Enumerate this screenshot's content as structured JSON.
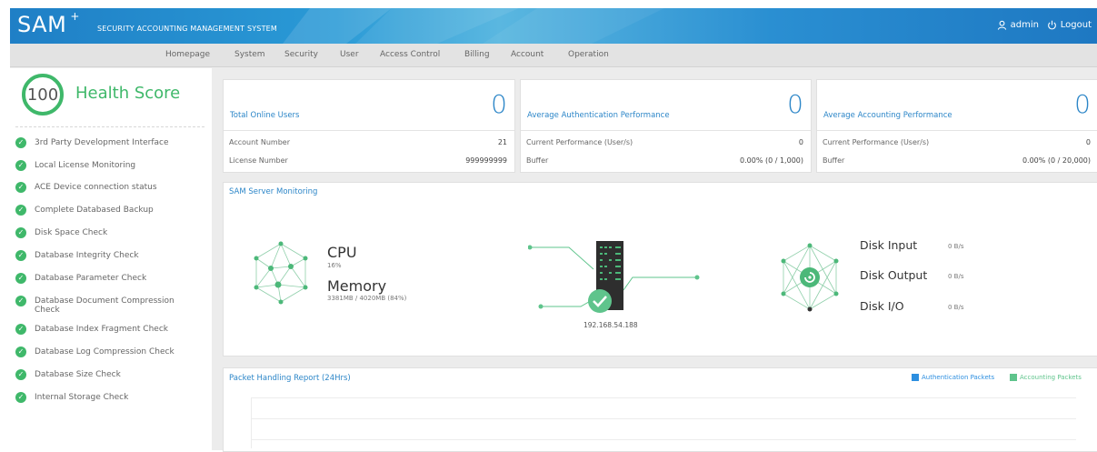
{
  "header": {
    "logo": "SAM",
    "logo_sup": "+",
    "subtitle": "SECURITY ACCOUNTING MANAGEMENT SYSTEM",
    "user": "admin",
    "logout": "Logout"
  },
  "nav": {
    "items": [
      "Homepage",
      "System",
      "Security",
      "User",
      "Access Control",
      "Billing",
      "Account",
      "Operation"
    ]
  },
  "health": {
    "score": "100",
    "label": "Health Score",
    "checks": [
      "3rd Party Development Interface",
      "Local License Monitoring",
      "ACE Device connection status",
      "Complete Databased Backup",
      "Disk Space Check",
      "Database Integrity Check",
      "Database Parameter Check",
      "Database Document Compression Check",
      "Database Index Fragment Check",
      "Database Log Compression Check",
      "Database Size Check",
      "Internal Storage Check"
    ]
  },
  "cards": {
    "online": {
      "title": "Total Online Users",
      "value": "0",
      "row1_label": "Account Number",
      "row1_value": "21",
      "row2_label": "License Number",
      "row2_value": "999999999"
    },
    "auth": {
      "title": "Average Authentication Performance",
      "value": "0",
      "row1_label": "Current Performance (User/s)",
      "row1_value": "0",
      "row2_label": "Buffer",
      "row2_value": "0.00% (0 / 1,000)"
    },
    "acct": {
      "title": "Average Accounting Performance",
      "value": "0",
      "row1_label": "Current Performance (User/s)",
      "row1_value": "0",
      "row2_label": "Buffer",
      "row2_value": "0.00% (0 / 20,000)"
    }
  },
  "monitor": {
    "title": "SAM Server Monitoring",
    "cpu_label": "CPU",
    "cpu_value": "16%",
    "memory_label": "Memory",
    "memory_value": "3381MB / 4020MB (84%)",
    "ip": "192.168.54.188",
    "disk_input_label": "Disk Input",
    "disk_input_value": "0 B/s",
    "disk_output_label": "Disk Output",
    "disk_output_value": "0 B/s",
    "disk_io_label": "Disk I/O",
    "disk_io_value": "0 B/s"
  },
  "report": {
    "title": "Packet Handling Report (24Hrs)",
    "legend_auth": "Authentication Packets",
    "legend_acct": "Accounting Packets",
    "colors": {
      "auth": "#2d8fe0",
      "acct": "#5fc48c"
    }
  }
}
